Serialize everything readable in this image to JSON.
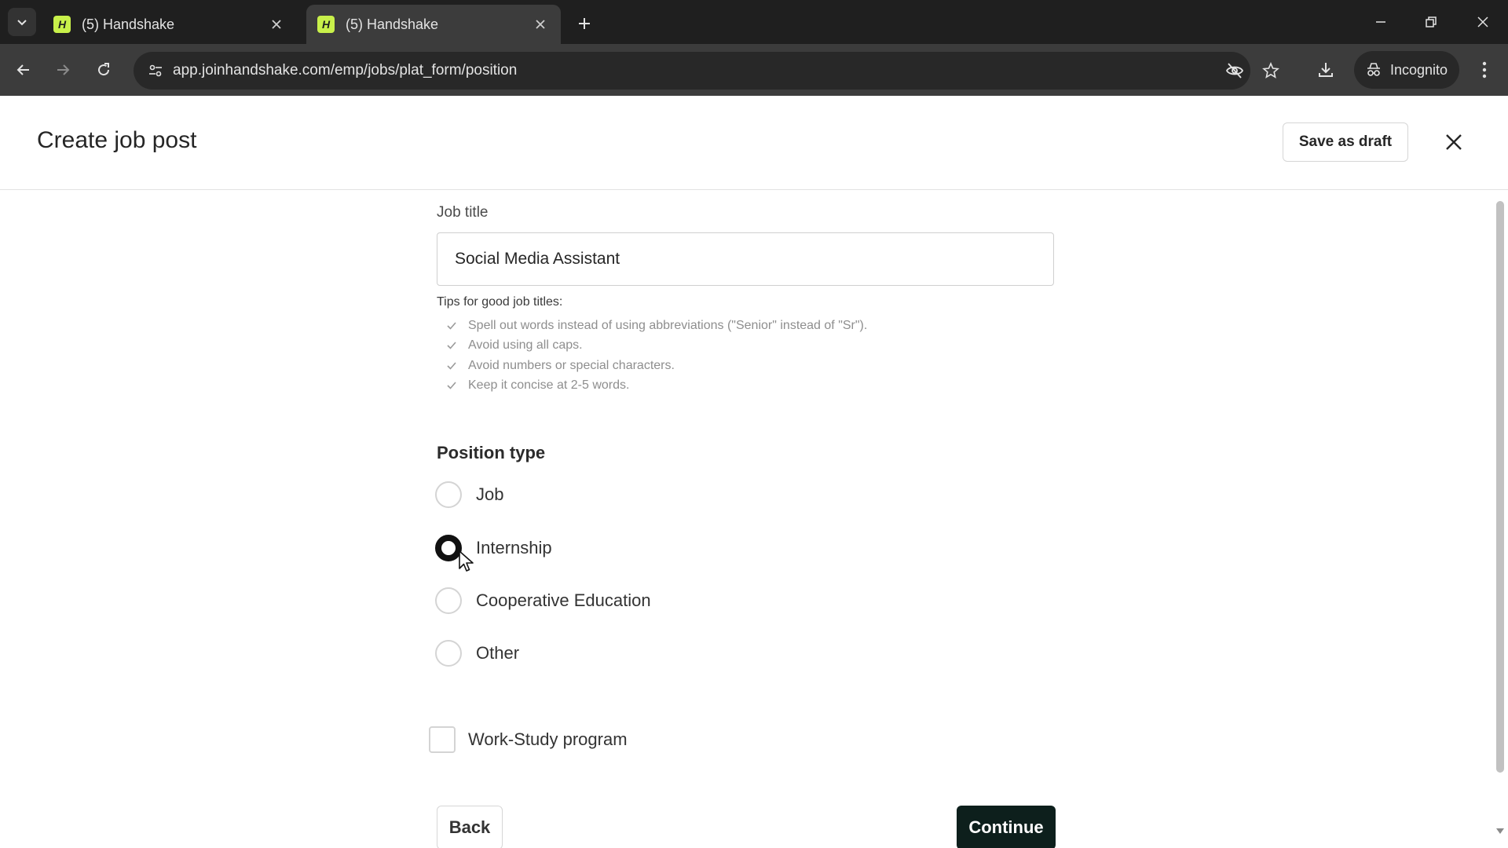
{
  "browser": {
    "tabs": [
      {
        "title": "(5) Handshake",
        "favicon": "H",
        "active": false
      },
      {
        "title": "(5) Handshake",
        "favicon": "H",
        "active": true
      }
    ],
    "url": "app.joinhandshake.com/emp/jobs/plat_form/position",
    "profile_label": "Incognito"
  },
  "header": {
    "title": "Create job post",
    "save_draft_label": "Save as draft"
  },
  "form": {
    "job_title_label": "Job title",
    "job_title_value": "Social Media Assistant",
    "tips_heading": "Tips for good job titles:",
    "tips": [
      "Spell out words instead of using abbreviations (\"Senior\" instead of \"Sr\").",
      "Avoid using all caps.",
      "Avoid numbers or special characters.",
      "Keep it concise at 2-5 words."
    ],
    "position_type_label": "Position type",
    "position_options": [
      {
        "label": "Job",
        "selected": false
      },
      {
        "label": "Internship",
        "selected": true
      },
      {
        "label": "Cooperative Education",
        "selected": false
      },
      {
        "label": "Other",
        "selected": false
      }
    ],
    "work_study_label": "Work-Study program",
    "work_study_checked": false,
    "back_label": "Back",
    "continue_label": "Continue"
  },
  "colors": {
    "tabstrip_bg": "#1f1f1f",
    "toolbar_bg": "#3c3c3c",
    "favicon_bg": "#c8f04a",
    "continue_bg": "#0d1f1c"
  },
  "icons": [
    "tab-search-icon",
    "close-icon",
    "plus-icon",
    "minimize-icon",
    "restore-icon",
    "back-arrow-icon",
    "forward-arrow-icon",
    "reload-icon",
    "site-settings-icon",
    "eye-off-icon",
    "star-icon",
    "download-icon",
    "incognito-icon",
    "more-vert-icon",
    "check-icon",
    "cursor-icon"
  ]
}
